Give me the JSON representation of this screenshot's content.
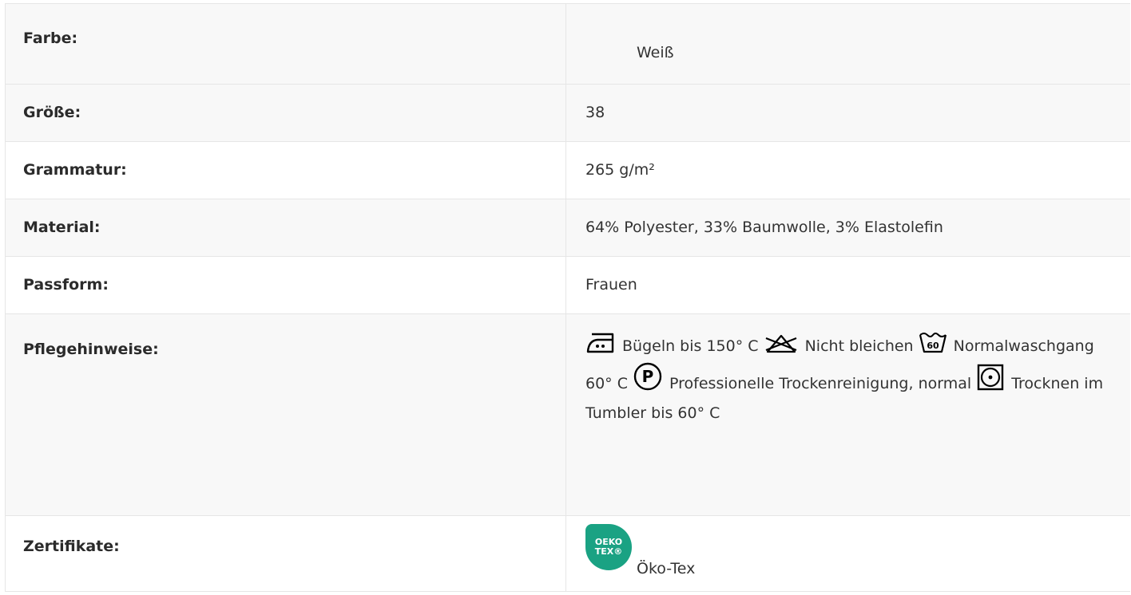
{
  "rows": [
    {
      "label": "Farbe:",
      "value": "Weiß"
    },
    {
      "label": "Größe:",
      "value": "38"
    },
    {
      "label": "Grammatur:",
      "value": "265 g/m²"
    },
    {
      "label": "Material:",
      "value": "64% Polyester, 33% Baumwolle, 3% Elastolefin"
    },
    {
      "label": "Passform:",
      "value": "Frauen"
    }
  ],
  "care": {
    "label": "Pflegehinweise:",
    "items": [
      {
        "icon": "iron-icon",
        "text": "Bügeln bis 150° C"
      },
      {
        "icon": "no-bleach-icon",
        "text": "Nicht bleichen"
      },
      {
        "icon": "wash-60-icon",
        "icon_text": "60",
        "text": "Normalwaschgang 60° C"
      },
      {
        "icon": "dry-clean-p-icon",
        "icon_text": "P",
        "text": "Professionelle Trockenreinigung, normal"
      },
      {
        "icon": "tumble-dry-icon",
        "text": "Trocknen im Tumbler bis 60° C"
      }
    ]
  },
  "certificates": {
    "label": "Zertifikate:",
    "logo_line1": "OEKO",
    "logo_line2": "TEX®",
    "value": "Öko-Tex",
    "logo_color": "#1aa283"
  }
}
